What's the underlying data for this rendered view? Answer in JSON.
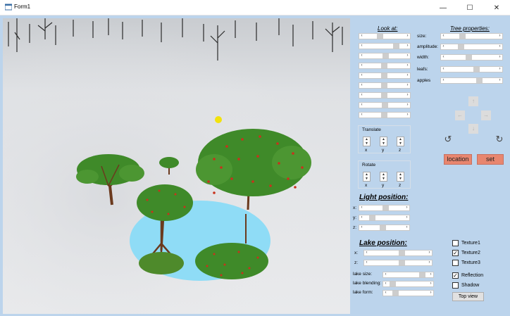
{
  "window": {
    "title": "Form1",
    "minimize": "—",
    "maximize": "☐",
    "close": "✕"
  },
  "look_at": {
    "heading": "Look at:",
    "sliders": [
      0.37,
      0.83,
      0.53,
      0.49,
      0.49,
      0.49,
      0.49,
      0.5,
      0.49
    ]
  },
  "tree_properties": {
    "heading": "Tree properties:",
    "rows": [
      {
        "label": "size:",
        "value": 0.3
      },
      {
        "label": "amplitude:",
        "value": 0.27
      },
      {
        "label": "width:",
        "value": 0.44
      },
      {
        "label": "leafs:",
        "value": 0.61
      },
      {
        "label": "apples",
        "value": 0.67
      }
    ]
  },
  "translate": {
    "label": "Translate",
    "axes": [
      "x",
      "y",
      "z"
    ]
  },
  "rotate": {
    "label": "Rotate",
    "axes": [
      "x",
      "y",
      "z"
    ]
  },
  "nav": {
    "up": "↑",
    "left": "←",
    "right": "→",
    "down": "↓",
    "rot_left": "↺",
    "rot_right": "↻"
  },
  "buttons": {
    "location": "location",
    "set": "set",
    "top_view": "Top view"
  },
  "light": {
    "heading": "Light position:",
    "rows": [
      {
        "label": "x:",
        "value": 0.55
      },
      {
        "label": "y:",
        "value": 0.14
      },
      {
        "label": "z:",
        "value": 0.45
      }
    ]
  },
  "lake": {
    "heading": "Lake position:",
    "rows": [
      {
        "label": "x:",
        "value": 0.57
      },
      {
        "label": "z:",
        "value": 0.57
      }
    ],
    "props": [
      {
        "label": "lake size:",
        "value": 0.92
      },
      {
        "label": "lake blending:",
        "value": 0.05
      },
      {
        "label": "lake form:",
        "value": 0.12
      }
    ]
  },
  "checkboxes": [
    {
      "label": "Texture1",
      "checked": false
    },
    {
      "label": "Texture2",
      "checked": true
    },
    {
      "label": "Texture3",
      "checked": false
    },
    {
      "label": "Reflection",
      "checked": true
    },
    {
      "label": "Shadow",
      "checked": false
    }
  ],
  "colors": {
    "panel": "#bcd4ec",
    "lake": "#8fdcf6",
    "button_accent": "#e8866f",
    "sun": "#f2e20d"
  }
}
